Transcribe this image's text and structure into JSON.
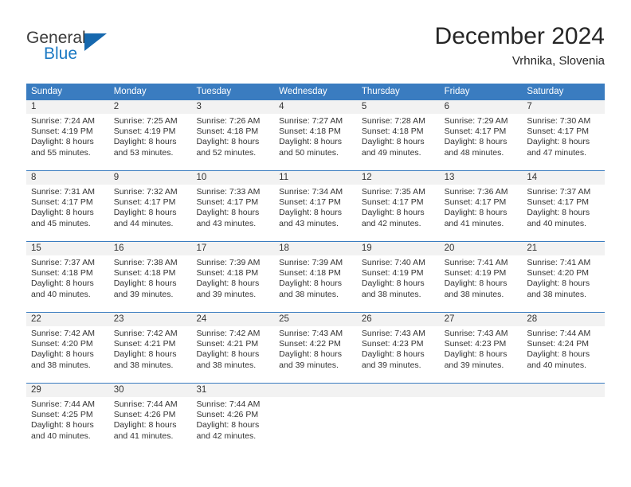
{
  "brand": {
    "name_top": "General",
    "name_bottom": "Blue",
    "triangle_color": "#1668ae",
    "blue_color": "#1b79c3"
  },
  "header": {
    "title": "December 2024",
    "subtitle": "Vrhnika, Slovenia"
  },
  "theme": {
    "header_blue": "#3a7cc0",
    "day_band_gray": "#f2f2f2",
    "text": "#333333"
  },
  "weekdays": [
    "Sunday",
    "Monday",
    "Tuesday",
    "Wednesday",
    "Thursday",
    "Friday",
    "Saturday"
  ],
  "labels": {
    "sunrise": "Sunrise:",
    "sunset": "Sunset:",
    "daylight": "Daylight:"
  },
  "weeks": [
    [
      {
        "day": "1",
        "sunrise": "Sunrise: 7:24 AM",
        "sunset": "Sunset: 4:19 PM",
        "daylight_1": "Daylight: 8 hours",
        "daylight_2": "and 55 minutes."
      },
      {
        "day": "2",
        "sunrise": "Sunrise: 7:25 AM",
        "sunset": "Sunset: 4:19 PM",
        "daylight_1": "Daylight: 8 hours",
        "daylight_2": "and 53 minutes."
      },
      {
        "day": "3",
        "sunrise": "Sunrise: 7:26 AM",
        "sunset": "Sunset: 4:18 PM",
        "daylight_1": "Daylight: 8 hours",
        "daylight_2": "and 52 minutes."
      },
      {
        "day": "4",
        "sunrise": "Sunrise: 7:27 AM",
        "sunset": "Sunset: 4:18 PM",
        "daylight_1": "Daylight: 8 hours",
        "daylight_2": "and 50 minutes."
      },
      {
        "day": "5",
        "sunrise": "Sunrise: 7:28 AM",
        "sunset": "Sunset: 4:18 PM",
        "daylight_1": "Daylight: 8 hours",
        "daylight_2": "and 49 minutes."
      },
      {
        "day": "6",
        "sunrise": "Sunrise: 7:29 AM",
        "sunset": "Sunset: 4:17 PM",
        "daylight_1": "Daylight: 8 hours",
        "daylight_2": "and 48 minutes."
      },
      {
        "day": "7",
        "sunrise": "Sunrise: 7:30 AM",
        "sunset": "Sunset: 4:17 PM",
        "daylight_1": "Daylight: 8 hours",
        "daylight_2": "and 47 minutes."
      }
    ],
    [
      {
        "day": "8",
        "sunrise": "Sunrise: 7:31 AM",
        "sunset": "Sunset: 4:17 PM",
        "daylight_1": "Daylight: 8 hours",
        "daylight_2": "and 45 minutes."
      },
      {
        "day": "9",
        "sunrise": "Sunrise: 7:32 AM",
        "sunset": "Sunset: 4:17 PM",
        "daylight_1": "Daylight: 8 hours",
        "daylight_2": "and 44 minutes."
      },
      {
        "day": "10",
        "sunrise": "Sunrise: 7:33 AM",
        "sunset": "Sunset: 4:17 PM",
        "daylight_1": "Daylight: 8 hours",
        "daylight_2": "and 43 minutes."
      },
      {
        "day": "11",
        "sunrise": "Sunrise: 7:34 AM",
        "sunset": "Sunset: 4:17 PM",
        "daylight_1": "Daylight: 8 hours",
        "daylight_2": "and 43 minutes."
      },
      {
        "day": "12",
        "sunrise": "Sunrise: 7:35 AM",
        "sunset": "Sunset: 4:17 PM",
        "daylight_1": "Daylight: 8 hours",
        "daylight_2": "and 42 minutes."
      },
      {
        "day": "13",
        "sunrise": "Sunrise: 7:36 AM",
        "sunset": "Sunset: 4:17 PM",
        "daylight_1": "Daylight: 8 hours",
        "daylight_2": "and 41 minutes."
      },
      {
        "day": "14",
        "sunrise": "Sunrise: 7:37 AM",
        "sunset": "Sunset: 4:17 PM",
        "daylight_1": "Daylight: 8 hours",
        "daylight_2": "and 40 minutes."
      }
    ],
    [
      {
        "day": "15",
        "sunrise": "Sunrise: 7:37 AM",
        "sunset": "Sunset: 4:18 PM",
        "daylight_1": "Daylight: 8 hours",
        "daylight_2": "and 40 minutes."
      },
      {
        "day": "16",
        "sunrise": "Sunrise: 7:38 AM",
        "sunset": "Sunset: 4:18 PM",
        "daylight_1": "Daylight: 8 hours",
        "daylight_2": "and 39 minutes."
      },
      {
        "day": "17",
        "sunrise": "Sunrise: 7:39 AM",
        "sunset": "Sunset: 4:18 PM",
        "daylight_1": "Daylight: 8 hours",
        "daylight_2": "and 39 minutes."
      },
      {
        "day": "18",
        "sunrise": "Sunrise: 7:39 AM",
        "sunset": "Sunset: 4:18 PM",
        "daylight_1": "Daylight: 8 hours",
        "daylight_2": "and 38 minutes."
      },
      {
        "day": "19",
        "sunrise": "Sunrise: 7:40 AM",
        "sunset": "Sunset: 4:19 PM",
        "daylight_1": "Daylight: 8 hours",
        "daylight_2": "and 38 minutes."
      },
      {
        "day": "20",
        "sunrise": "Sunrise: 7:41 AM",
        "sunset": "Sunset: 4:19 PM",
        "daylight_1": "Daylight: 8 hours",
        "daylight_2": "and 38 minutes."
      },
      {
        "day": "21",
        "sunrise": "Sunrise: 7:41 AM",
        "sunset": "Sunset: 4:20 PM",
        "daylight_1": "Daylight: 8 hours",
        "daylight_2": "and 38 minutes."
      }
    ],
    [
      {
        "day": "22",
        "sunrise": "Sunrise: 7:42 AM",
        "sunset": "Sunset: 4:20 PM",
        "daylight_1": "Daylight: 8 hours",
        "daylight_2": "and 38 minutes."
      },
      {
        "day": "23",
        "sunrise": "Sunrise: 7:42 AM",
        "sunset": "Sunset: 4:21 PM",
        "daylight_1": "Daylight: 8 hours",
        "daylight_2": "and 38 minutes."
      },
      {
        "day": "24",
        "sunrise": "Sunrise: 7:42 AM",
        "sunset": "Sunset: 4:21 PM",
        "daylight_1": "Daylight: 8 hours",
        "daylight_2": "and 38 minutes."
      },
      {
        "day": "25",
        "sunrise": "Sunrise: 7:43 AM",
        "sunset": "Sunset: 4:22 PM",
        "daylight_1": "Daylight: 8 hours",
        "daylight_2": "and 39 minutes."
      },
      {
        "day": "26",
        "sunrise": "Sunrise: 7:43 AM",
        "sunset": "Sunset: 4:23 PM",
        "daylight_1": "Daylight: 8 hours",
        "daylight_2": "and 39 minutes."
      },
      {
        "day": "27",
        "sunrise": "Sunrise: 7:43 AM",
        "sunset": "Sunset: 4:23 PM",
        "daylight_1": "Daylight: 8 hours",
        "daylight_2": "and 39 minutes."
      },
      {
        "day": "28",
        "sunrise": "Sunrise: 7:44 AM",
        "sunset": "Sunset: 4:24 PM",
        "daylight_1": "Daylight: 8 hours",
        "daylight_2": "and 40 minutes."
      }
    ],
    [
      {
        "day": "29",
        "sunrise": "Sunrise: 7:44 AM",
        "sunset": "Sunset: 4:25 PM",
        "daylight_1": "Daylight: 8 hours",
        "daylight_2": "and 40 minutes."
      },
      {
        "day": "30",
        "sunrise": "Sunrise: 7:44 AM",
        "sunset": "Sunset: 4:26 PM",
        "daylight_1": "Daylight: 8 hours",
        "daylight_2": "and 41 minutes."
      },
      {
        "day": "31",
        "sunrise": "Sunrise: 7:44 AM",
        "sunset": "Sunset: 4:26 PM",
        "daylight_1": "Daylight: 8 hours",
        "daylight_2": "and 42 minutes."
      },
      {
        "day": "",
        "sunrise": "",
        "sunset": "",
        "daylight_1": "",
        "daylight_2": ""
      },
      {
        "day": "",
        "sunrise": "",
        "sunset": "",
        "daylight_1": "",
        "daylight_2": ""
      },
      {
        "day": "",
        "sunrise": "",
        "sunset": "",
        "daylight_1": "",
        "daylight_2": ""
      },
      {
        "day": "",
        "sunrise": "",
        "sunset": "",
        "daylight_1": "",
        "daylight_2": ""
      }
    ]
  ]
}
